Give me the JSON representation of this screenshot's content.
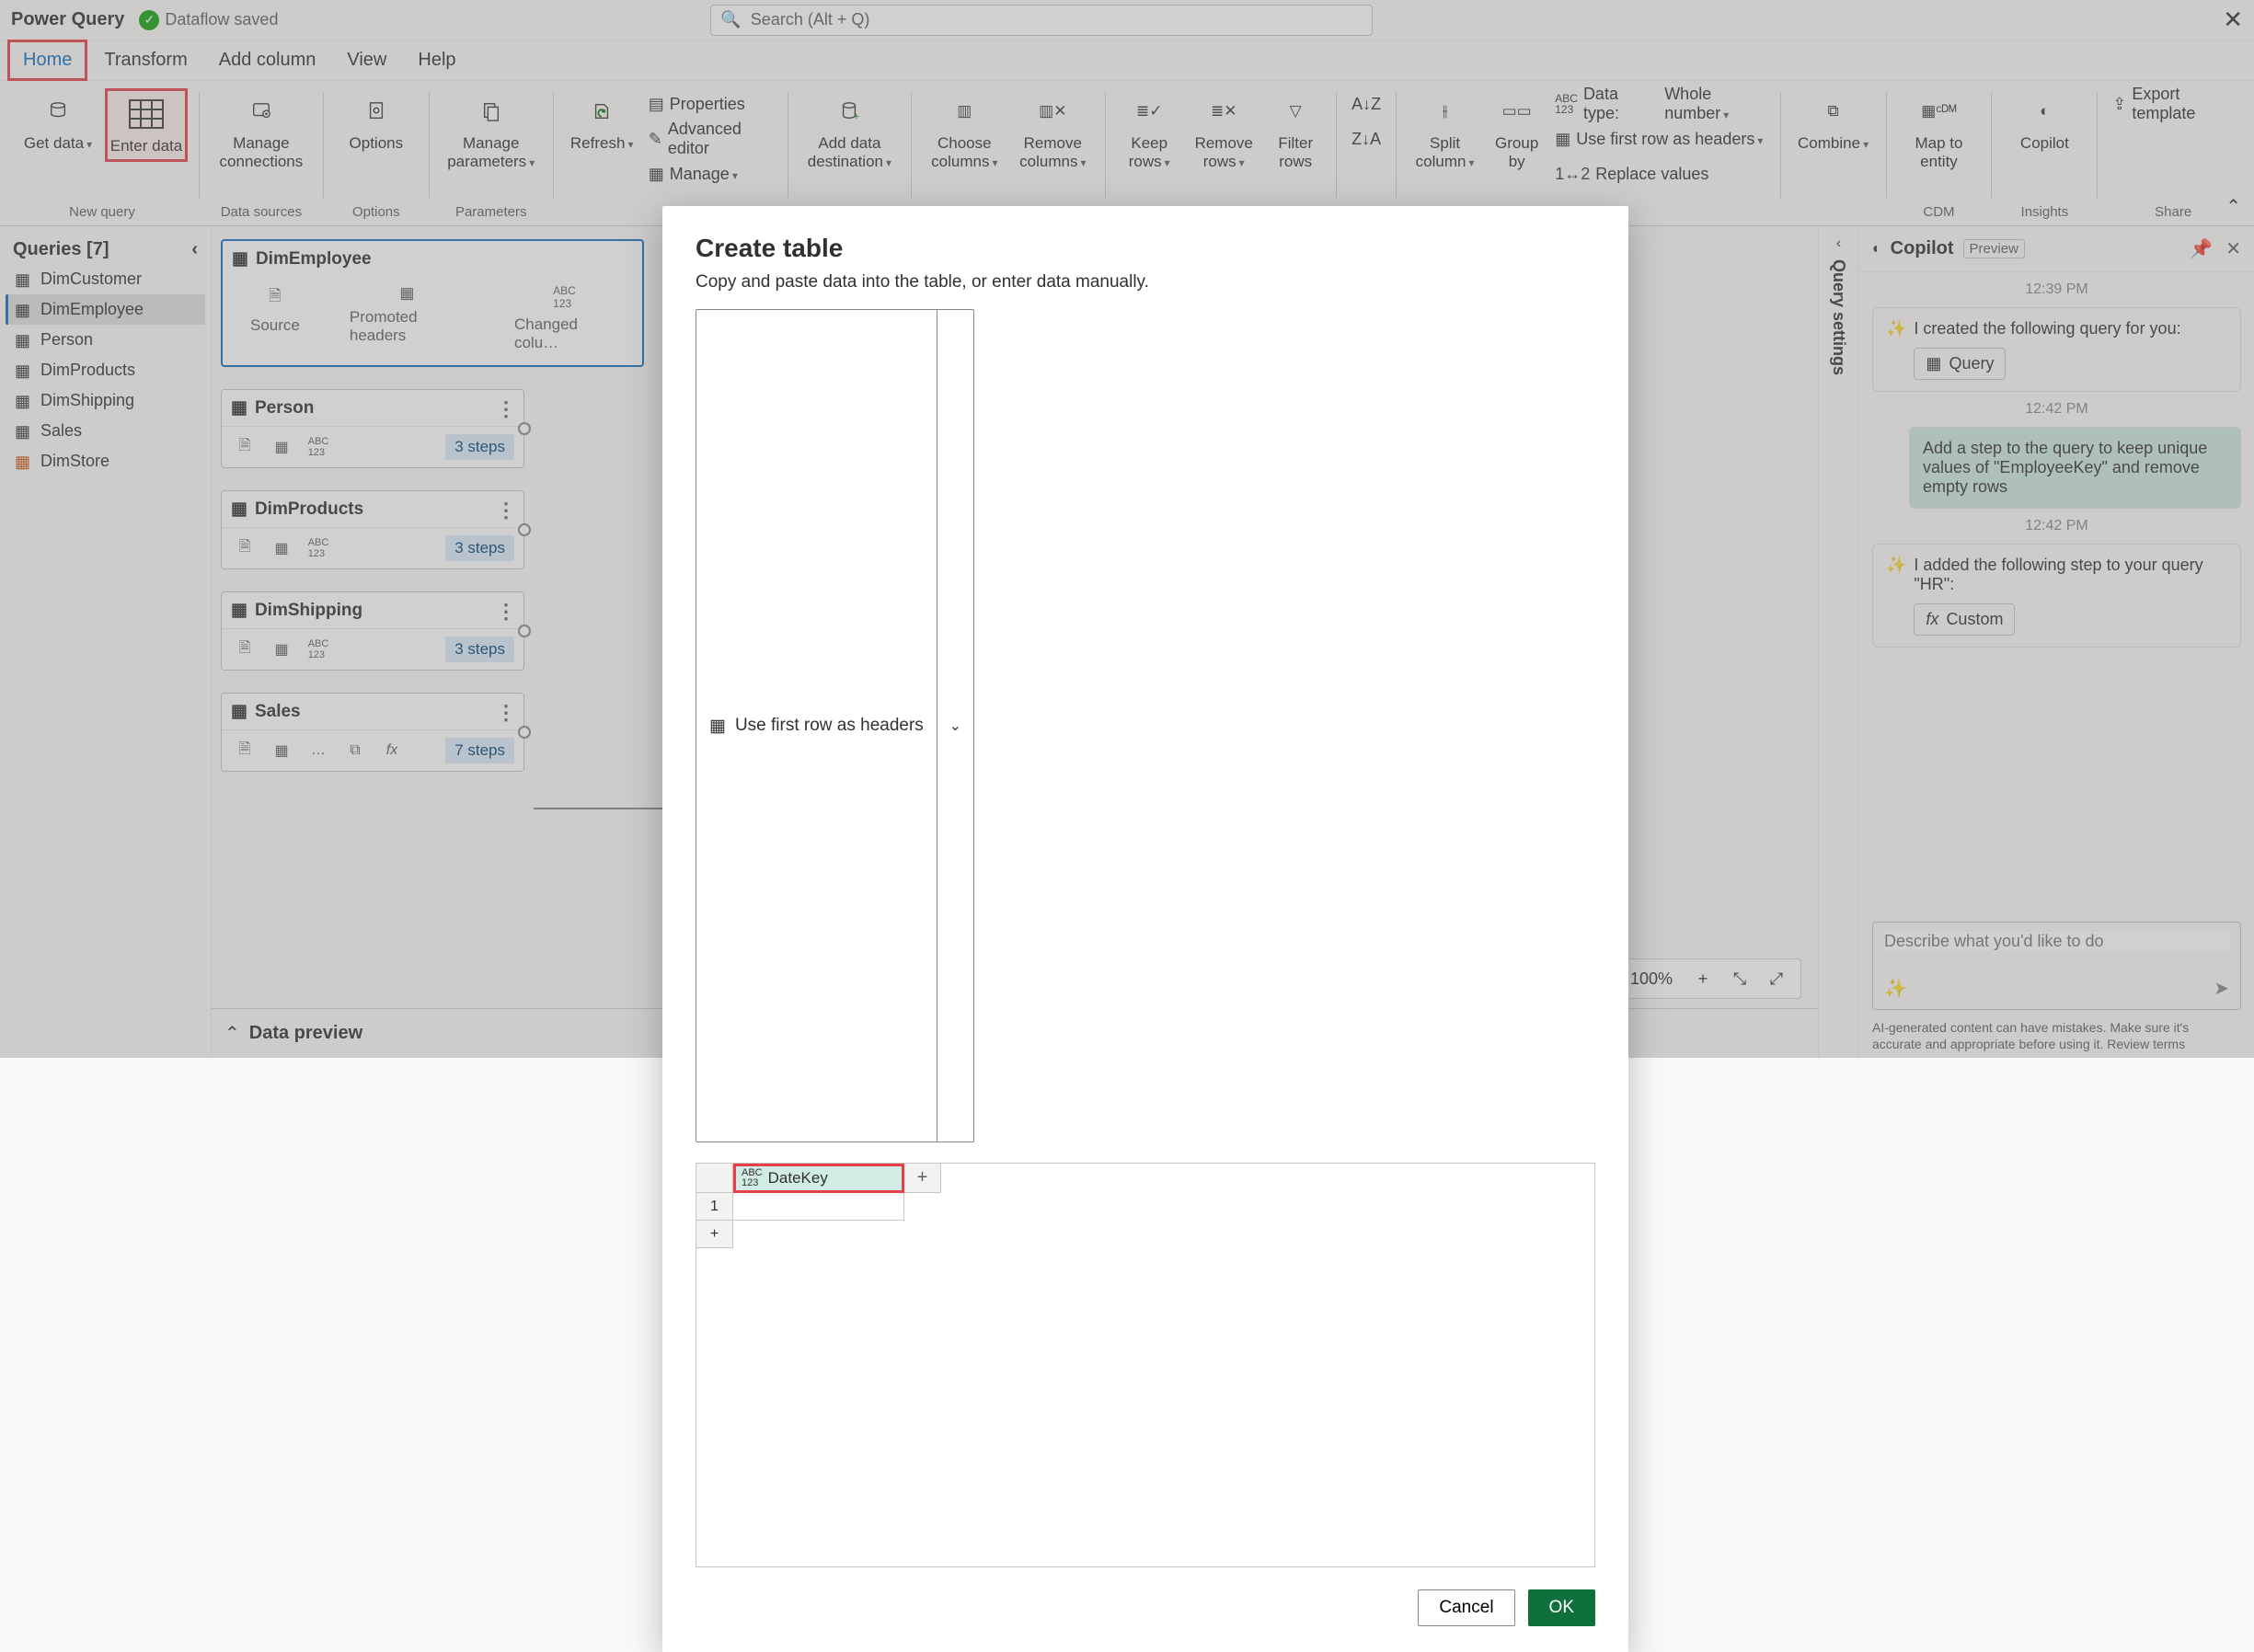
{
  "titlebar": {
    "app": "Power Query",
    "status": "Dataflow saved",
    "search_placeholder": "Search (Alt + Q)"
  },
  "tabs": [
    "Home",
    "Transform",
    "Add column",
    "View",
    "Help"
  ],
  "ribbon": {
    "new_query": {
      "get_data": "Get data",
      "enter_data": "Enter data",
      "label": "New query"
    },
    "data_sources": {
      "manage_connections": "Manage connections",
      "label": "Data sources"
    },
    "options": {
      "options": "Options",
      "label": "Options"
    },
    "parameters": {
      "manage_parameters": "Manage parameters",
      "label": "Parameters"
    },
    "query": {
      "refresh": "Refresh",
      "properties": "Properties",
      "advanced_editor": "Advanced editor",
      "manage": "Manage"
    },
    "add_data_destination": "Add data destination",
    "columns": {
      "choose": "Choose columns",
      "remove": "Remove columns"
    },
    "rows": {
      "keep": "Keep rows",
      "remove": "Remove rows",
      "filter": "Filter rows"
    },
    "split": "Split column",
    "group": "Group by",
    "transform": {
      "datatype_label": "Data type:",
      "datatype_value": "Whole number",
      "first_row": "Use first row as headers",
      "replace": "Replace values"
    },
    "combine": "Combine",
    "map": "Map to entity",
    "copilot": "Copilot",
    "export": "Export template",
    "groups": {
      "cdm": "CDM",
      "insights": "Insights",
      "share": "Share"
    }
  },
  "queries": {
    "header": "Queries [7]",
    "items": [
      "DimCustomer",
      "DimEmployee",
      "Person",
      "DimProducts",
      "DimShipping",
      "Sales",
      "DimStore"
    ],
    "selected": "DimEmployee"
  },
  "diagram": {
    "dimemployee": {
      "title": "DimEmployee",
      "steps": [
        "Source",
        "Promoted headers",
        "Changed colu…"
      ]
    },
    "person": {
      "title": "Person",
      "badge": "3 steps"
    },
    "dimproducts": {
      "title": "DimProducts",
      "badge": "3 steps"
    },
    "dimshipping": {
      "title": "DimShipping",
      "badge": "3 steps"
    },
    "sales": {
      "title": "Sales",
      "badge": "7 steps"
    }
  },
  "viewport": {
    "zoom": "100%"
  },
  "preview": {
    "title": "Data preview"
  },
  "copilot": {
    "title": "Copilot",
    "badge": "Preview",
    "ts1": "12:39 PM",
    "m1": "I created the following query for you:",
    "m1_pill": "Query",
    "ts2": "12:42 PM",
    "m2": "Add a step to the query to keep unique values of \"EmployeeKey\" and remove empty rows",
    "ts3": "12:42 PM",
    "m3": "I added the following step to your query \"HR\":",
    "m3_pill": "Custom",
    "input_placeholder": "Describe what you'd like to do",
    "disclaimer": "AI-generated content can have mistakes. Make sure it's accurate and appropriate before using it. Review terms"
  },
  "settings_label": "Query settings",
  "modal": {
    "title": "Create table",
    "subtitle": "Copy and paste data into the table, or enter data manually.",
    "headers_btn": "Use first row as headers",
    "col1": "DateKey",
    "row1": "1",
    "cancel": "Cancel",
    "ok": "OK"
  }
}
